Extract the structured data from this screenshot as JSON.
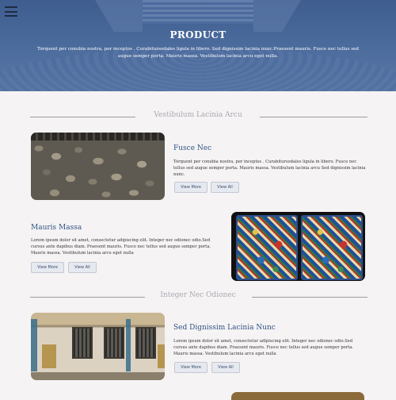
{
  "hero": {
    "title": "PRODUCT",
    "text": "Torquent per conubia nostra, per inceptos . Curabitursodales ligula in libero. Sed dignissim lacinia nunc.Praesent mauris. Fusce nec tellus sed augue semper porta. Mauris massa. Vestibulum lacinia arcu eget nulla."
  },
  "sections": [
    {
      "heading": "Vestibulum Lacinia Arcu"
    },
    {
      "heading": "Integer Nec Odionec"
    }
  ],
  "rows": [
    {
      "title": "Fusce Nec",
      "text": "Torquent per conubia nostra, per inceptos . Curabitursodales ligula in libero. Fusce nec tellus sed augue semper porta. Mauris massa. Vestibulum lacinia arcu Sed dignissim lacinia nunc.",
      "more": "View More",
      "all": "View All"
    },
    {
      "title": "Mauris Massa",
      "text": "Lorem ipsum dolor sit amet, consectetur adipiscing elit. Integer nec odionec odio.Sed cursus ante dapibus diam. Praesent mauris. Fusce nec tellus sed augue semper porta. Mauris massa. Vestibulum lacinia arcu eget nulla",
      "more": "View More",
      "all": "View All"
    },
    {
      "title": "Sed Dignissim Lacinia Nunc",
      "text": "Lorem ipsum dolor sit amet, consectetur adipiscing elit. Integer nec odionec odio.Sed cursus ante dapibus diam. Praesent mauris. Fusce nec tellus sed augue semper porta. Mauris massa. Vestibulum lacinia arcu eget nulla",
      "more": "View More",
      "all": "View All"
    }
  ],
  "colors": {
    "hero_blue": "#4a6a9c",
    "title_blue": "#2f5584",
    "heading_gray": "#a7a9b0"
  },
  "icons": {
    "menu": "hamburger-menu-icon"
  }
}
